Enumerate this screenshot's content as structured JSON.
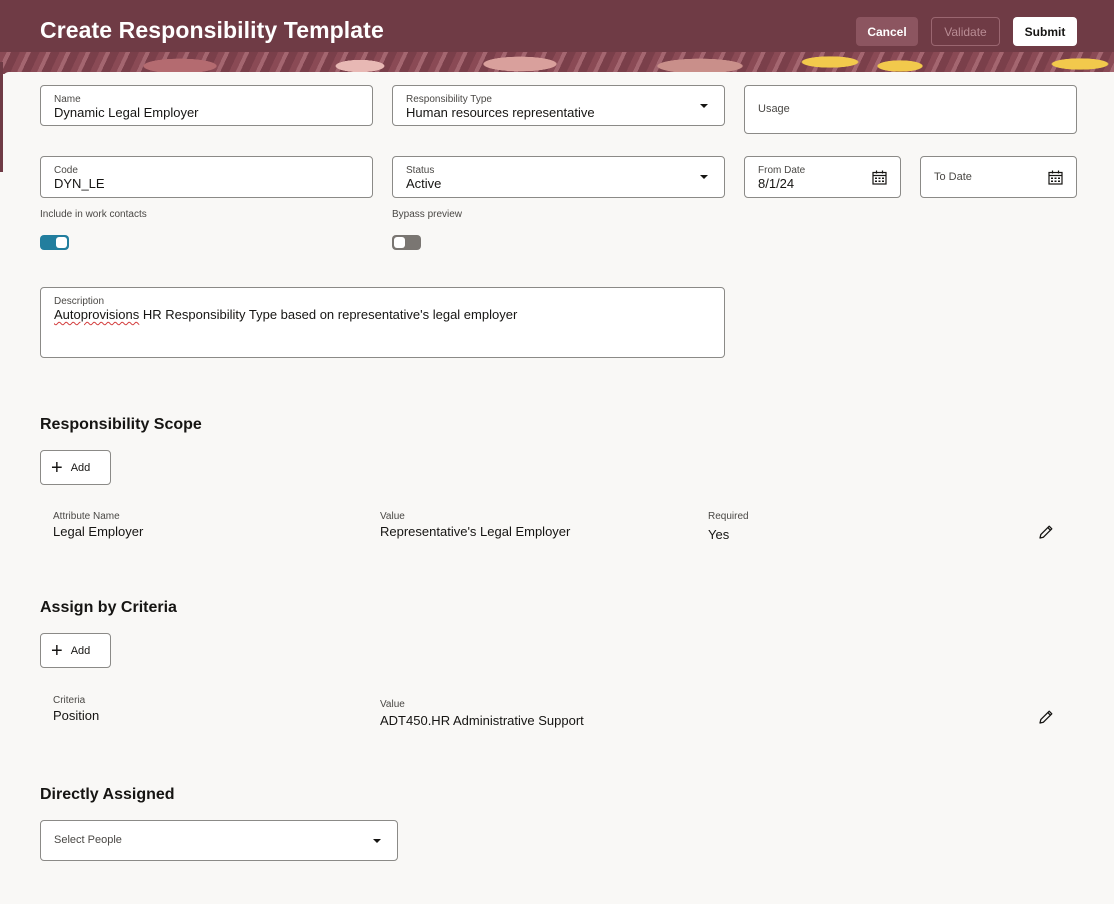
{
  "header": {
    "title": "Create Responsibility Template",
    "cancel_label": "Cancel",
    "validate_label": "Validate",
    "submit_label": "Submit"
  },
  "form": {
    "name": {
      "label": "Name",
      "value": "Dynamic Legal Employer"
    },
    "responsibility_type": {
      "label": "Responsibility Type",
      "value": "Human resources representative"
    },
    "usage": {
      "label": "Usage"
    },
    "code": {
      "label": "Code",
      "value": "DYN_LE"
    },
    "status": {
      "label": "Status",
      "value": "Active"
    },
    "from_date": {
      "label": "From Date",
      "value": "8/1/24"
    },
    "to_date": {
      "label": "To Date"
    },
    "include_work_contacts": {
      "label": "Include in work contacts",
      "enabled": true
    },
    "bypass_preview": {
      "label": "Bypass preview",
      "enabled": false
    },
    "description": {
      "label": "Description",
      "first_word": "Autoprovisions",
      "rest": " HR Responsibility Type based on representative's legal employer"
    }
  },
  "responsibility_scope": {
    "title": "Responsibility Scope",
    "add_label": "Add",
    "columns": {
      "attribute": "Attribute Name",
      "value": "Value",
      "required": "Required"
    },
    "row": {
      "attribute": "Legal Employer",
      "value": "Representative's Legal Employer",
      "required": "Yes"
    }
  },
  "assign_by_criteria": {
    "title": "Assign by Criteria",
    "add_label": "Add",
    "columns": {
      "criteria": "Criteria",
      "value": "Value"
    },
    "row": {
      "criteria": "Position",
      "value": "ADT450.HR Administrative Support"
    }
  },
  "directly_assigned": {
    "title": "Directly Assigned",
    "placeholder": "Select People"
  },
  "colors": {
    "header": "#6f3b45",
    "toggle_on": "#227e9e",
    "toggle_off": "#7a7672",
    "background": "#f9f8f6"
  },
  "icons": [
    "calendar-icon",
    "chevron-down-icon",
    "plus-icon",
    "pencil-icon"
  ]
}
